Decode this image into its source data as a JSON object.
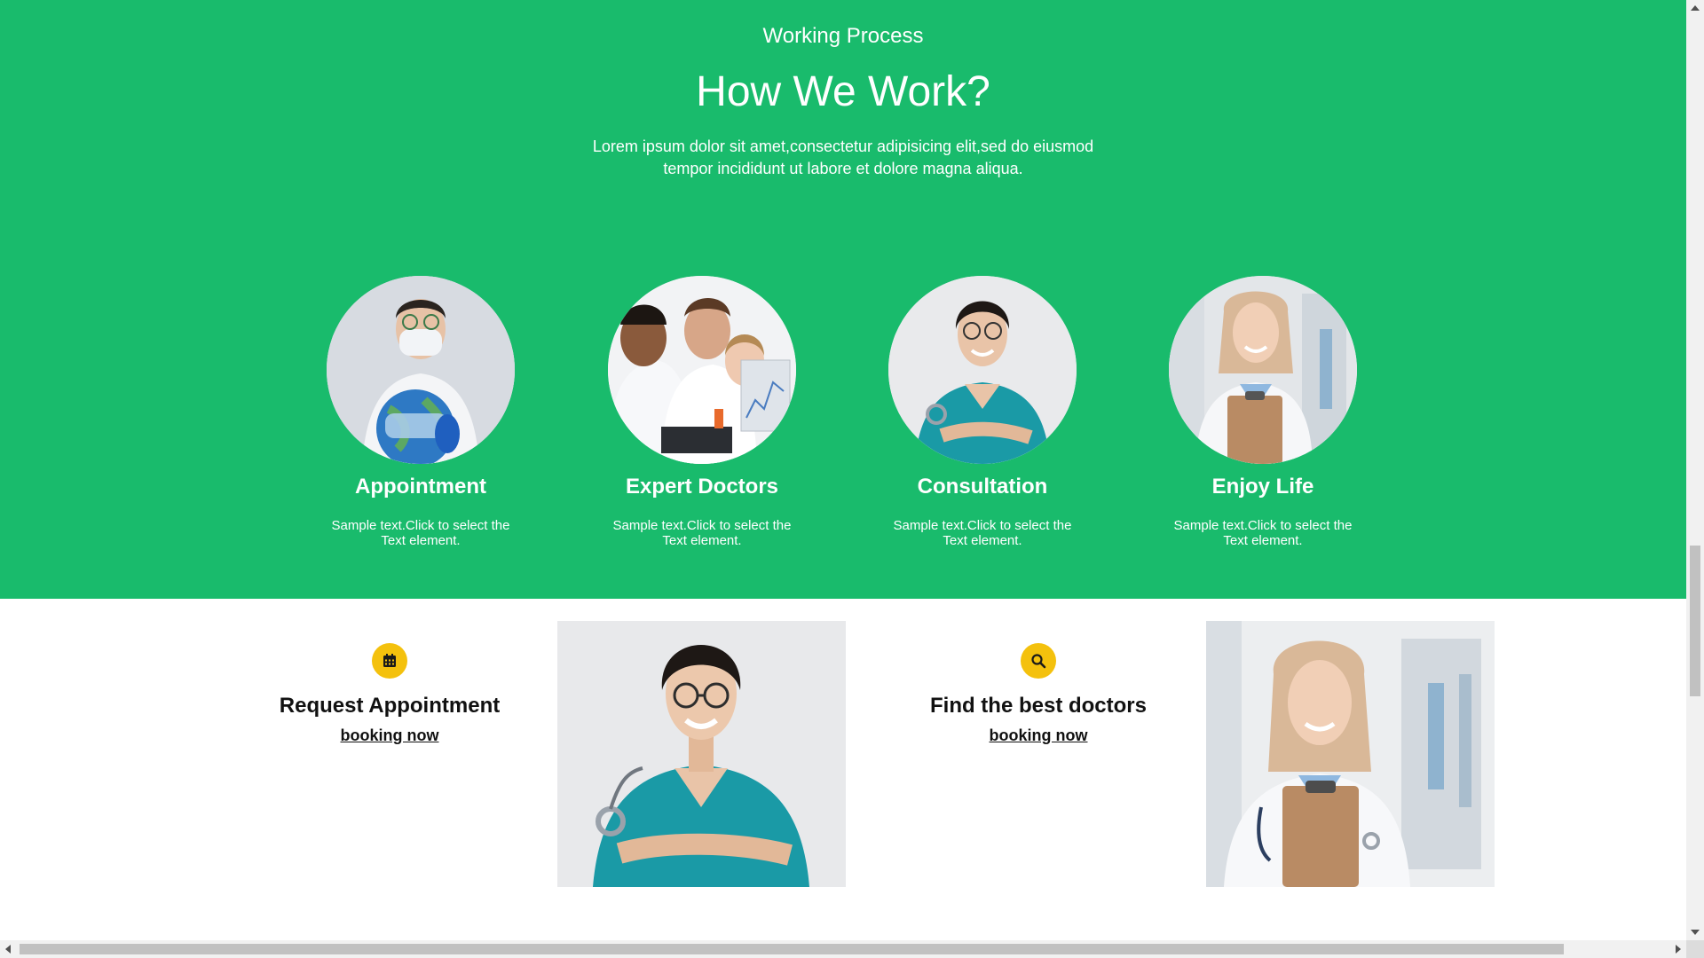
{
  "hero": {
    "eyebrow": "Working Process",
    "title": "How We Work?",
    "lead_line1": "Lorem ipsum dolor sit amet,consectetur adipisicing elit,sed do eiusmod",
    "lead_line2": "tempor incididunt ut labore et dolore magna aliqua.",
    "background_color": "#19bb6c"
  },
  "steps": [
    {
      "title": "Appointment",
      "text": "Sample text.Click to select the Text element.",
      "photo": "doctor-with-mask-and-globe"
    },
    {
      "title": "Expert Doctors",
      "text": "Sample text.Click to select the Text element.",
      "photo": "doctors-team-at-laptop"
    },
    {
      "title": "Consultation",
      "text": "Sample text.Click to select the Text element.",
      "photo": "nurse-in-teal-scrubs"
    },
    {
      "title": "Enjoy Life",
      "text": "Sample text.Click to select the Text element.",
      "photo": "doctor-with-clipboard"
    }
  ],
  "cta": [
    {
      "title": "Request Appointment",
      "link": "booking now",
      "icon": "calendar-icon"
    },
    {
      "title": "Find the best doctors",
      "link": "booking now",
      "icon": "search-icon"
    }
  ],
  "photos": [
    {
      "subject": "nurse-in-teal-scrubs"
    },
    {
      "subject": "doctor-with-clipboard"
    }
  ],
  "colors": {
    "accent_yellow": "#f4c10d",
    "text_dark": "#111111",
    "white": "#ffffff"
  }
}
